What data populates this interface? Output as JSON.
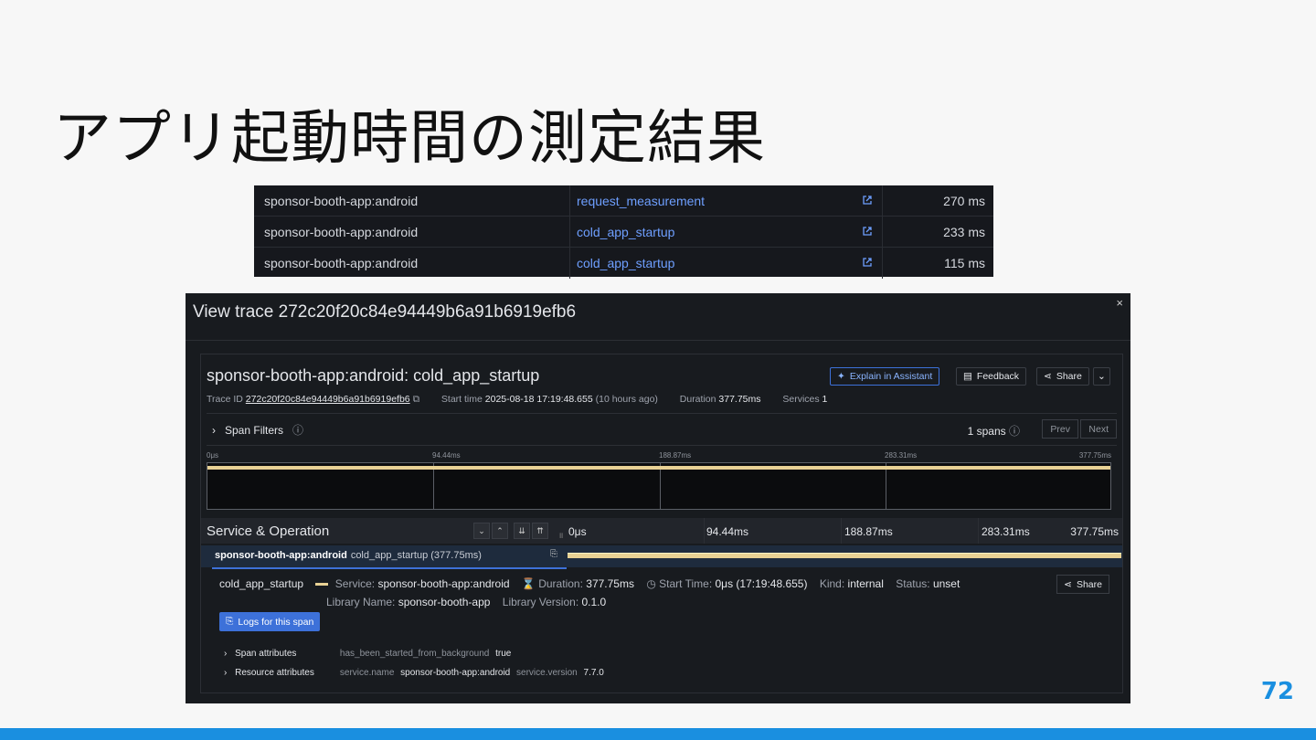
{
  "slide": {
    "title": "アプリ起動時間の測定結果",
    "page_number": "72"
  },
  "results_table": {
    "rows": [
      {
        "service": "sponsor-booth-app:android",
        "operation": "request_measurement",
        "duration": "270 ms"
      },
      {
        "service": "sponsor-booth-app:android",
        "operation": "cold_app_startup",
        "duration": "233 ms"
      },
      {
        "service": "sponsor-booth-app:android",
        "operation": "cold_app_startup",
        "duration": "115 ms"
      }
    ]
  },
  "trace": {
    "window_title": "View trace 272c20f20c84e94449b6a91b6919efb6",
    "close_label": "×",
    "op_title": "sponsor-booth-app:android: cold_app_startup",
    "trace_id_label": "Trace ID",
    "trace_id": "272c20f20c84e94449b6a91b6919efb6",
    "start_time_label": "Start time",
    "start_time": "2025-08-18 17:19:48.655",
    "start_time_rel": "(10 hours ago)",
    "duration_label": "Duration",
    "duration": "377.75ms",
    "services_label": "Services",
    "services": "1",
    "buttons": {
      "assistant": "Explain in Assistant",
      "feedback": "Feedback",
      "share": "Share"
    },
    "span_filters_label": "Span Filters",
    "spans_count": "1 spans",
    "prev_label": "Prev",
    "next_label": "Next",
    "minimap_ticks": [
      "0μs",
      "94.44ms",
      "188.87ms",
      "283.31ms",
      "377.75ms"
    ],
    "timeline_header": "Service & Operation",
    "timeline_ticks": [
      "0μs",
      "94.44ms",
      "188.87ms",
      "283.31ms",
      "377.75ms"
    ],
    "span": {
      "service": "sponsor-booth-app:android",
      "operation": "cold_app_startup (377.75ms)",
      "bar_fraction": 1.0
    },
    "detail": {
      "name": "cold_app_startup",
      "service_label": "Service:",
      "service": "sponsor-booth-app:android",
      "duration_label": "Duration:",
      "duration": "377.75ms",
      "start_label": "Start Time:",
      "start": "0μs (17:19:48.655)",
      "kind_label": "Kind:",
      "kind": "internal",
      "status_label": "Status:",
      "status": "unset",
      "lib_name_label": "Library Name:",
      "lib_name": "sponsor-booth-app",
      "lib_version_label": "Library Version:",
      "lib_version": "0.1.0",
      "share_label": "Share",
      "logs_button": "Logs for this span",
      "span_attr_label": "Span attributes",
      "span_attr_key": "has_been_started_from_background",
      "span_attr_val": "true",
      "res_attr_label": "Resource attributes",
      "res_attr_key1": "service.name",
      "res_attr_val1": "sponsor-booth-app:android",
      "res_attr_key2": "service.version",
      "res_attr_val2": "7.7.0"
    }
  },
  "colors": {
    "accent_blue": "#1a8fe0",
    "span_bar": "#e8d194",
    "link_blue": "#6e9fff"
  }
}
